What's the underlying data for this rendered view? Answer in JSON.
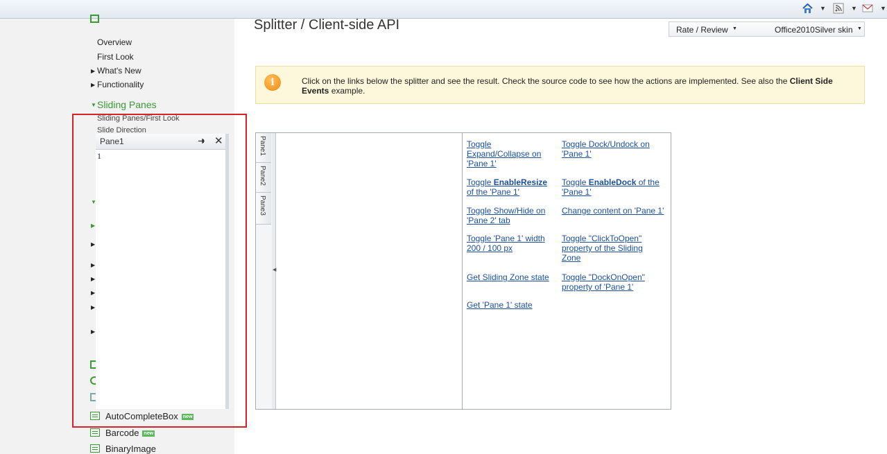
{
  "browser": {
    "icons": [
      "home-icon",
      "rss-icon",
      "mail-icon"
    ]
  },
  "nav": {
    "items": [
      {
        "label": "Overview"
      },
      {
        "label": "First Look"
      },
      {
        "label": "What's New"
      },
      {
        "label": "Functionality"
      }
    ],
    "section": "Sliding Panes",
    "subitems": [
      "Sliding Panes/First Look",
      "Slide Direction"
    ],
    "bottom": [
      {
        "label": "AutoCompleteBox",
        "badge": "new"
      },
      {
        "label": "Barcode",
        "badge": "new"
      },
      {
        "label": "BinaryImage"
      }
    ]
  },
  "overlay_pane": {
    "title": "Pane1",
    "content": "1"
  },
  "page": {
    "title": "Splitter / Client-side API",
    "rate_review": "Rate / Review",
    "skin": "Office2010Silver skin",
    "info_text": "Click on the links below the splitter and see the result. Check the source code to see how the actions are implemented. See also the ",
    "info_bold": "Client Side Events",
    "info_end": " example."
  },
  "splitter": {
    "tabs": [
      "Pane1",
      "Pane2",
      "Pane3"
    ],
    "links_left": [
      {
        "pre": "Toggle Expand/Collapse on 'Pane 1'",
        "bold": "",
        "post": ""
      },
      {
        "pre": "Toggle ",
        "bold": "EnableResize",
        "post": " of the 'Pane 1'"
      },
      {
        "pre": "Toggle Show/Hide on 'Pane 2' tab",
        "bold": "",
        "post": ""
      },
      {
        "pre": "Toggle 'Pane 1' width 200 / 100 px",
        "bold": "",
        "post": ""
      },
      {
        "pre": "Get Sliding Zone state",
        "bold": "",
        "post": ""
      },
      {
        "pre": "Get 'Pane 1' state",
        "bold": "",
        "post": ""
      }
    ],
    "links_right": [
      {
        "pre": "Toggle Dock/Undock on 'Pane 1'",
        "bold": "",
        "post": ""
      },
      {
        "pre": "Toggle ",
        "bold": "EnableDock",
        "post": " of the 'Pane 1'"
      },
      {
        "pre": "Change content on 'Pane 1'",
        "bold": "",
        "post": ""
      },
      {
        "pre": "Toggle \"ClickToOpen\" property of the Sliding Zone",
        "bold": "",
        "post": ""
      },
      {
        "pre": "Toggle \"DockOnOpen\" property of 'Pane 1'",
        "bold": "",
        "post": ""
      }
    ]
  }
}
